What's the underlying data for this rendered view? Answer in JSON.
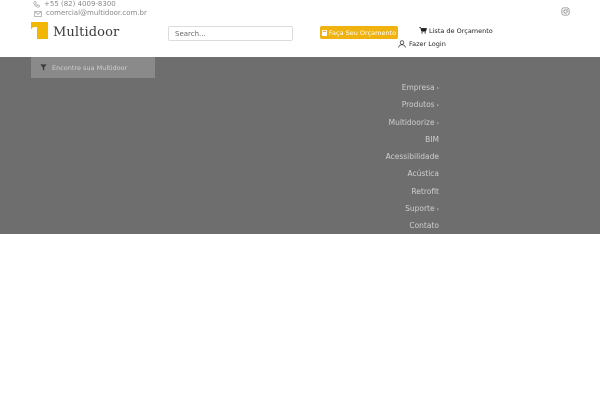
{
  "topbar": {
    "phone": "+55 (82) 4009-8300",
    "email": "comercial@multidoor.com.br",
    "social_icon": "instagram-icon"
  },
  "brand": {
    "name": "Multidoor",
    "accent": "#f2b705"
  },
  "search": {
    "placeholder": "Search..."
  },
  "header_actions": {
    "quote_label": "Faça Seu Orçamento",
    "list_label": "Lista de Orçamento",
    "login_label": "Fazer Login"
  },
  "finder": {
    "label": "Encontre sua Multidoor"
  },
  "menu": {
    "items": [
      {
        "label": "Empresa",
        "has_submenu": true
      },
      {
        "label": "Produtos",
        "has_submenu": true
      },
      {
        "label": "Multidoorize",
        "has_submenu": true
      },
      {
        "label": "BIM",
        "has_submenu": false
      },
      {
        "label": "Acessibilidade",
        "has_submenu": false
      },
      {
        "label": "Acústica",
        "has_submenu": false
      },
      {
        "label": "Retrofit",
        "has_submenu": false
      },
      {
        "label": "Suporte",
        "has_submenu": true
      },
      {
        "label": "Contato",
        "has_submenu": false
      }
    ]
  },
  "colors": {
    "overlay": "#6e6e6e",
    "button": "#f0b20e"
  }
}
